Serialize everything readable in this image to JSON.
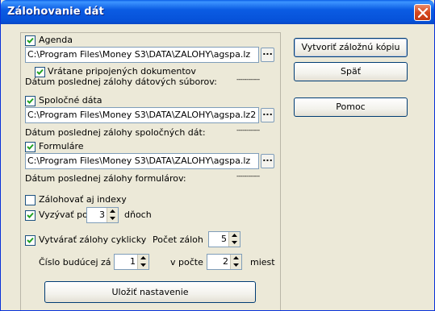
{
  "window": {
    "title": "Zálohovanie dát"
  },
  "agenda": {
    "label": "Agenda",
    "checked": true,
    "path": "C:\\Program Files\\Money S3\\DATA\\ZALOHY\\agspa.lz",
    "include_docs_label": "Vrátane pripojených dokumentov",
    "include_docs_checked": true,
    "last_backup_label": "Dátum poslednej zálohy dátových súborov:",
    "last_backup_value": "------------"
  },
  "shared": {
    "label": "Spoločné dáta",
    "checked": true,
    "path": "C:\\Program Files\\Money S3\\DATA\\ZALOHY\\agspa.lz2",
    "last_backup_label": "Dátum poslednej zálohy spoločných dát:",
    "last_backup_value": "------------"
  },
  "forms": {
    "label": "Formuláre",
    "checked": true,
    "path": "C:\\Program Files\\Money S3\\DATA\\ZALOHY\\agspa.lz",
    "last_backup_label": "Dátum poslednej zálohy formulárov:",
    "last_backup_value": "------------"
  },
  "options": {
    "index_label": "Zálohovať aj indexy",
    "index_checked": false,
    "prompt_label": "Vyzývať po",
    "prompt_checked": true,
    "prompt_days": "3",
    "prompt_days_unit": "dňoch",
    "cyclic_label": "Vytvárať zálohy cyklicky",
    "cyclic_checked": true,
    "count_label": "Počet záloh",
    "count_value": "5",
    "next_label": "Číslo budúcej zálohy",
    "next_value": "1",
    "in_order_label": "v počte",
    "in_order_value": "2",
    "places_label": "miest"
  },
  "buttons": {
    "save_settings": "Uložiť nastavenie",
    "create_backup": "Vytvoriť záložnú kópiu",
    "back": "Späť",
    "help": "Pomoc"
  }
}
